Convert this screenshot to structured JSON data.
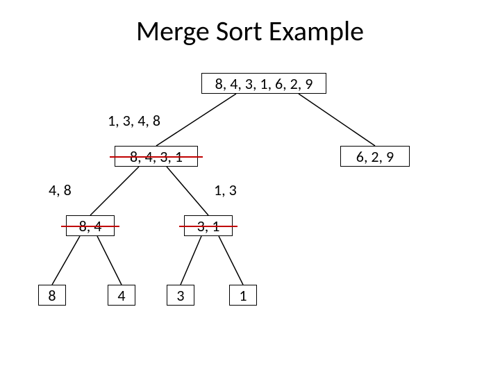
{
  "title": "Merge Sort Example",
  "nodes": {
    "root": "8, 4, 3, 1, 6, 2, 9",
    "l1_left": "8, 4, 3, 1",
    "l1_right": "6, 2, 9",
    "l2_a": "8, 4",
    "l2_b": "3, 1",
    "l3_a": "8",
    "l3_b": "4",
    "l3_c": "3",
    "l3_d": "1"
  },
  "merged_labels": {
    "root_left_result": "1, 3, 4, 8",
    "l1_left_left_result": "4, 8",
    "l1_left_right_result": "1, 3"
  },
  "chart_data": {
    "type": "tree",
    "description": "Merge sort recursive decomposition of [8,4,3,1,6,2,9]. Left half fully decomposed to leaves; sorted merge results annotated beside processed nodes (strikethrough indicates replaced by sorted result).",
    "input": [
      8,
      4,
      3,
      1,
      6,
      2,
      9
    ],
    "tree": {
      "value": [
        8,
        4,
        3,
        1,
        6,
        2,
        9
      ],
      "children": [
        {
          "value": [
            8,
            4,
            3,
            1
          ],
          "sorted": [
            1,
            3,
            4,
            8
          ],
          "struck": true,
          "children": [
            {
              "value": [
                8,
                4
              ],
              "sorted": [
                4,
                8
              ],
              "struck": true,
              "children": [
                {
                  "value": [
                    8
                  ]
                },
                {
                  "value": [
                    4
                  ]
                }
              ]
            },
            {
              "value": [
                3,
                1
              ],
              "sorted": [
                1,
                3
              ],
              "struck": true,
              "children": [
                {
                  "value": [
                    3
                  ]
                },
                {
                  "value": [
                    1
                  ]
                }
              ]
            }
          ]
        },
        {
          "value": [
            6,
            2,
            9
          ]
        }
      ]
    }
  }
}
